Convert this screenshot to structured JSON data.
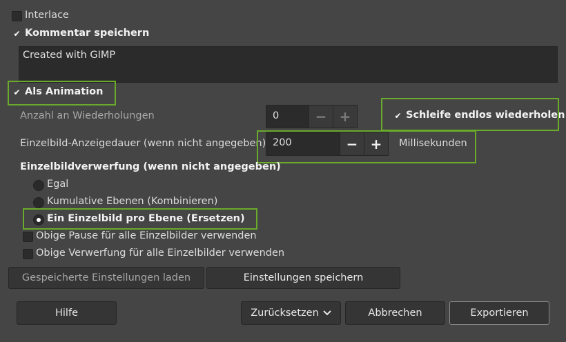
{
  "options": {
    "interlace": "Interlace",
    "save_comment": "Kommentar speichern",
    "comment_text": "Created with GIMP",
    "as_animation": "Als Animation"
  },
  "animation": {
    "repeat_label": "Anzahl an Wiederholungen",
    "repeat_value": "0",
    "loop_label": "Schleife endlos wiederholen",
    "delay_label": "Einzelbild-Anzeigedauer (wenn nicht angegeben)",
    "delay_value": "200",
    "delay_unit": "Millisekunden",
    "disposal_heading": "Einzelbildverwerfung (wenn nicht angegeben)",
    "disposal_options": [
      "Egal",
      "Kumulative Ebenen (Kombinieren)",
      "Ein Einzelbild pro Ebene (Ersetzen)"
    ],
    "use_delay_all": "Obige Pause für alle Einzelbilder verwenden",
    "use_disposal_all": "Obige Verwerfung für alle Einzelbilder verwenden",
    "minus": "−",
    "plus": "+"
  },
  "settings": {
    "load_label": "Gespeicherte Einstellungen laden",
    "save_label": "Einstellungen speichern"
  },
  "footer": {
    "help": "Hilfe",
    "reset": "Zurücksetzen",
    "cancel": "Abbrechen",
    "export": "Exportieren"
  }
}
